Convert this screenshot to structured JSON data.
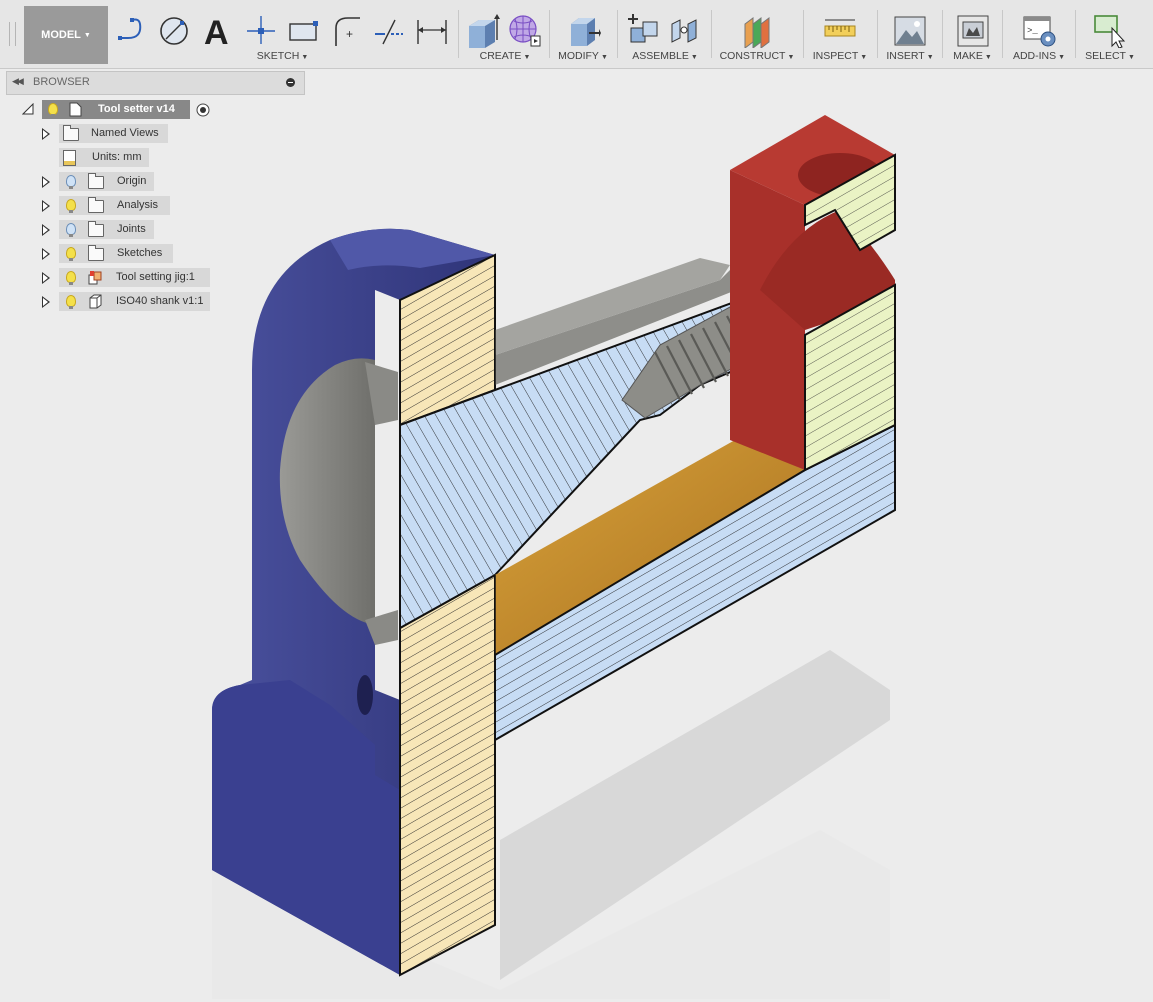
{
  "toolbar": {
    "workspace": "MODEL",
    "groups": [
      {
        "label": "SKETCH"
      },
      {
        "label": "CREATE"
      },
      {
        "label": "MODIFY"
      },
      {
        "label": "ASSEMBLE"
      },
      {
        "label": "CONSTRUCT"
      },
      {
        "label": "INSPECT"
      },
      {
        "label": "INSERT"
      },
      {
        "label": "MAKE"
      },
      {
        "label": "ADD-INS"
      },
      {
        "label": "SELECT"
      }
    ],
    "icons": [
      "line-icon",
      "circle-icon",
      "text-icon",
      "point-icon",
      "rectangle-icon",
      "fillet-icon",
      "trim-icon",
      "dimension-icon",
      "extrude-icon",
      "form-icon",
      "press-pull-icon",
      "new-component-icon",
      "joint-icon",
      "offset-plane-icon",
      "measure-icon",
      "insert-image-icon",
      "3d-print-icon",
      "scripts-icon",
      "select-icon"
    ]
  },
  "browser": {
    "title": "BROWSER",
    "root": {
      "label": "Tool setter v14"
    },
    "items": [
      {
        "label": "Named Views",
        "icon": "folder-icon",
        "bulb": "none"
      },
      {
        "label": "Units: mm",
        "icon": "document-icon",
        "bulb": "none"
      },
      {
        "label": "Origin",
        "icon": "folder-icon",
        "bulb": "off"
      },
      {
        "label": "Analysis",
        "icon": "folder-icon",
        "bulb": "on"
      },
      {
        "label": "Joints",
        "icon": "folder-icon",
        "bulb": "off"
      },
      {
        "label": "Sketches",
        "icon": "folder-icon",
        "bulb": "on"
      },
      {
        "label": "Tool setting jig:1",
        "icon": "component-icon",
        "bulb": "on"
      },
      {
        "label": "ISO40 shank v1:1",
        "icon": "body-icon",
        "bulb": "on"
      }
    ]
  },
  "colors": {
    "toolbar_bg": "#e6e6e6",
    "workspace_btn": "#9a9a9a",
    "viewport_bg": "#ececec",
    "body_blue": "#3a3f8a",
    "body_red": "#a8302a",
    "section_tan": "#f7e6b8",
    "section_blue": "#c7dcf4",
    "section_green": "#eaf3c4",
    "shank_grey": "#8a8a86",
    "base_gold": "#c89030"
  }
}
